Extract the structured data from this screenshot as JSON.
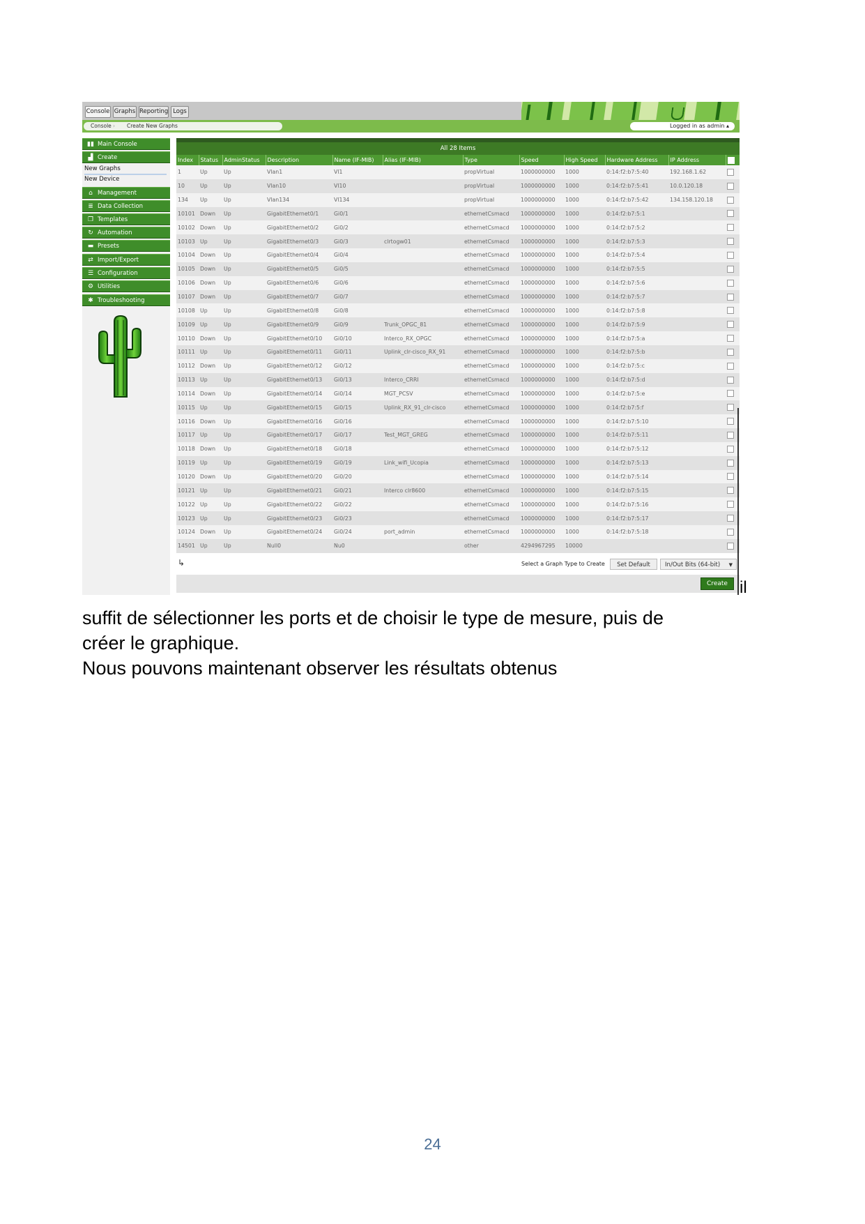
{
  "screenshot": {
    "top_tabs": [
      "Console",
      "Graphs",
      "Reporting",
      "Logs"
    ],
    "breadcrumb": [
      "Console",
      "Create New Graphs"
    ],
    "login_text": "Logged in as admin",
    "sidebar": [
      {
        "label": "Main Console",
        "icon": "chart-bar-icon",
        "glyph": "▮▮"
      },
      {
        "label": "Create",
        "icon": "chart-area-icon",
        "glyph": "▟"
      },
      {
        "label": "New Graphs",
        "sub": true
      },
      {
        "label": "New Device",
        "sub": true
      },
      {
        "label": "Management",
        "icon": "home-icon",
        "glyph": "⌂"
      },
      {
        "label": "Data Collection",
        "icon": "database-icon",
        "glyph": "≣"
      },
      {
        "label": "Templates",
        "icon": "copy-icon",
        "glyph": "❐"
      },
      {
        "label": "Automation",
        "icon": "refresh-icon",
        "glyph": "↻"
      },
      {
        "label": "Presets",
        "icon": "folder-icon",
        "glyph": "▬"
      },
      {
        "label": "Import/Export",
        "icon": "exchange-icon",
        "glyph": "⇄"
      },
      {
        "label": "Configuration",
        "icon": "sliders-icon",
        "glyph": "☰"
      },
      {
        "label": "Utilities",
        "icon": "cogs-icon",
        "glyph": "⚙"
      },
      {
        "label": "Troubleshooting",
        "icon": "bug-icon",
        "glyph": "✱"
      }
    ],
    "table": {
      "title": "All 28 Items",
      "columns": [
        "Index",
        "Status",
        "AdminStatus",
        "Description",
        "Name (IF-MIB)",
        "Alias (IF-MIB)",
        "Type",
        "Speed",
        "High Speed",
        "Hardware Address",
        "IP Address"
      ],
      "rows": [
        [
          "1",
          "Up",
          "Up",
          "Vlan1",
          "Vl1",
          "",
          "propVirtual",
          "1000000000",
          "1000",
          "0:14:f2:b7:5:40",
          "192.168.1.62"
        ],
        [
          "10",
          "Up",
          "Up",
          "Vlan10",
          "Vl10",
          "",
          "propVirtual",
          "1000000000",
          "1000",
          "0:14:f2:b7:5:41",
          "10.0.120.18"
        ],
        [
          "134",
          "Up",
          "Up",
          "Vlan134",
          "Vl134",
          "",
          "propVirtual",
          "1000000000",
          "1000",
          "0:14:f2:b7:5:42",
          "134.158.120.18"
        ],
        [
          "10101",
          "Down",
          "Up",
          "GigabitEthernet0/1",
          "Gi0/1",
          "",
          "ethernetCsmacd",
          "1000000000",
          "1000",
          "0:14:f2:b7:5:1",
          ""
        ],
        [
          "10102",
          "Down",
          "Up",
          "GigabitEthernet0/2",
          "Gi0/2",
          "",
          "ethernetCsmacd",
          "1000000000",
          "1000",
          "0:14:f2:b7:5:2",
          ""
        ],
        [
          "10103",
          "Up",
          "Up",
          "GigabitEthernet0/3",
          "Gi0/3",
          "clrtogw01",
          "ethernetCsmacd",
          "1000000000",
          "1000",
          "0:14:f2:b7:5:3",
          ""
        ],
        [
          "10104",
          "Down",
          "Up",
          "GigabitEthernet0/4",
          "Gi0/4",
          "",
          "ethernetCsmacd",
          "1000000000",
          "1000",
          "0:14:f2:b7:5:4",
          ""
        ],
        [
          "10105",
          "Down",
          "Up",
          "GigabitEthernet0/5",
          "Gi0/5",
          "",
          "ethernetCsmacd",
          "1000000000",
          "1000",
          "0:14:f2:b7:5:5",
          ""
        ],
        [
          "10106",
          "Down",
          "Up",
          "GigabitEthernet0/6",
          "Gi0/6",
          "",
          "ethernetCsmacd",
          "1000000000",
          "1000",
          "0:14:f2:b7:5:6",
          ""
        ],
        [
          "10107",
          "Down",
          "Up",
          "GigabitEthernet0/7",
          "Gi0/7",
          "",
          "ethernetCsmacd",
          "1000000000",
          "1000",
          "0:14:f2:b7:5:7",
          ""
        ],
        [
          "10108",
          "Up",
          "Up",
          "GigabitEthernet0/8",
          "Gi0/8",
          "",
          "ethernetCsmacd",
          "1000000000",
          "1000",
          "0:14:f2:b7:5:8",
          ""
        ],
        [
          "10109",
          "Up",
          "Up",
          "GigabitEthernet0/9",
          "Gi0/9",
          "Trunk_OPGC_81",
          "ethernetCsmacd",
          "1000000000",
          "1000",
          "0:14:f2:b7:5:9",
          ""
        ],
        [
          "10110",
          "Down",
          "Up",
          "GigabitEthernet0/10",
          "Gi0/10",
          "Interco_RX_OPGC",
          "ethernetCsmacd",
          "1000000000",
          "1000",
          "0:14:f2:b7:5:a",
          ""
        ],
        [
          "10111",
          "Up",
          "Up",
          "GigabitEthernet0/11",
          "Gi0/11",
          "Uplink_clr-cisco_RX_91",
          "ethernetCsmacd",
          "1000000000",
          "1000",
          "0:14:f2:b7:5:b",
          ""
        ],
        [
          "10112",
          "Down",
          "Up",
          "GigabitEthernet0/12",
          "Gi0/12",
          "",
          "ethernetCsmacd",
          "1000000000",
          "1000",
          "0:14:f2:b7:5:c",
          ""
        ],
        [
          "10113",
          "Up",
          "Up",
          "GigabitEthernet0/13",
          "Gi0/13",
          "Interco_CRRI",
          "ethernetCsmacd",
          "1000000000",
          "1000",
          "0:14:f2:b7:5:d",
          ""
        ],
        [
          "10114",
          "Down",
          "Up",
          "GigabitEthernet0/14",
          "Gi0/14",
          "MGT_PCSV",
          "ethernetCsmacd",
          "1000000000",
          "1000",
          "0:14:f2:b7:5:e",
          ""
        ],
        [
          "10115",
          "Up",
          "Up",
          "GigabitEthernet0/15",
          "Gi0/15",
          "Uplink_RX_91_clr-cisco",
          "ethernetCsmacd",
          "1000000000",
          "1000",
          "0:14:f2:b7:5:f",
          ""
        ],
        [
          "10116",
          "Down",
          "Up",
          "GigabitEthernet0/16",
          "Gi0/16",
          "",
          "ethernetCsmacd",
          "1000000000",
          "1000",
          "0:14:f2:b7:5:10",
          ""
        ],
        [
          "10117",
          "Up",
          "Up",
          "GigabitEthernet0/17",
          "Gi0/17",
          "Test_MGT_GREG",
          "ethernetCsmacd",
          "1000000000",
          "1000",
          "0:14:f2:b7:5:11",
          ""
        ],
        [
          "10118",
          "Down",
          "Up",
          "GigabitEthernet0/18",
          "Gi0/18",
          "",
          "ethernetCsmacd",
          "1000000000",
          "1000",
          "0:14:f2:b7:5:12",
          ""
        ],
        [
          "10119",
          "Up",
          "Up",
          "GigabitEthernet0/19",
          "Gi0/19",
          "Link_wifi_Ucopia",
          "ethernetCsmacd",
          "1000000000",
          "1000",
          "0:14:f2:b7:5:13",
          ""
        ],
        [
          "10120",
          "Down",
          "Up",
          "GigabitEthernet0/20",
          "Gi0/20",
          "",
          "ethernetCsmacd",
          "1000000000",
          "1000",
          "0:14:f2:b7:5:14",
          ""
        ],
        [
          "10121",
          "Up",
          "Up",
          "GigabitEthernet0/21",
          "Gi0/21",
          "Interco clr8600",
          "ethernetCsmacd",
          "1000000000",
          "1000",
          "0:14:f2:b7:5:15",
          ""
        ],
        [
          "10122",
          "Up",
          "Up",
          "GigabitEthernet0/22",
          "Gi0/22",
          "",
          "ethernetCsmacd",
          "1000000000",
          "1000",
          "0:14:f2:b7:5:16",
          ""
        ],
        [
          "10123",
          "Up",
          "Up",
          "GigabitEthernet0/23",
          "Gi0/23",
          "",
          "ethernetCsmacd",
          "1000000000",
          "1000",
          "0:14:f2:b7:5:17",
          ""
        ],
        [
          "10124",
          "Down",
          "Up",
          "GigabitEthernet0/24",
          "Gi0/24",
          "port_admin",
          "ethernetCsmacd",
          "1000000000",
          "1000",
          "0:14:f2:b7:5:18",
          ""
        ],
        [
          "14501",
          "Up",
          "Up",
          "Null0",
          "Nu0",
          "",
          "other",
          "4294967295",
          "10000",
          "",
          ""
        ]
      ]
    },
    "graph_type_label": "Select a Graph Type to Create",
    "set_default_label": "Set Default",
    "graph_type_value": "In/Out Bits (64-bit)",
    "create_label": "Create"
  },
  "document": {
    "trailing_word": "il",
    "line1": "suffit de sélectionner les ports et de choisir le type de mesure, puis de",
    "line2": "créer le graphique.",
    "line3": "Nous pouvons maintenant observer les résultats obtenus",
    "page_number": "24"
  },
  "colors": {
    "accent_green": "#3f8d2a",
    "dark_green": "#3d7a25",
    "page_number_blue": "#4a6e96"
  }
}
